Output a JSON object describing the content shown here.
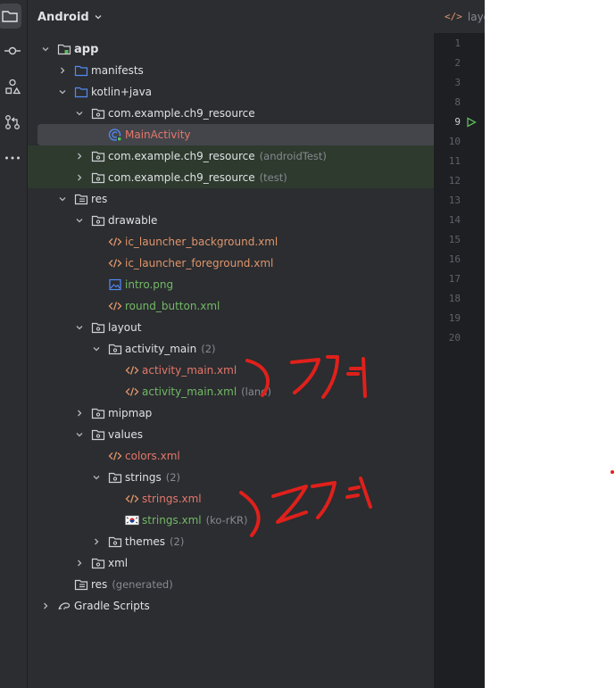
{
  "panel": {
    "view_name": "Android"
  },
  "tree": [
    {
      "label": "app",
      "type": "module",
      "level": 0,
      "expanded": true
    },
    {
      "label": "manifests",
      "type": "folder",
      "level": 1,
      "expanded": false
    },
    {
      "label": "kotlin+java",
      "type": "folder",
      "level": 1,
      "expanded": true
    },
    {
      "label": "com.example.ch9_resource",
      "type": "package",
      "level": 2,
      "expanded": true
    },
    {
      "label": "MainActivity",
      "type": "class",
      "level": 3,
      "color": "red",
      "selected": true
    },
    {
      "label": "com.example.ch9_resource",
      "type": "package",
      "level": 2,
      "expanded": false,
      "hint": "(androidTest)",
      "test": true
    },
    {
      "label": "com.example.ch9_resource",
      "type": "package",
      "level": 2,
      "expanded": false,
      "hint": "(test)",
      "test": true
    },
    {
      "label": "res",
      "type": "resfolder",
      "level": 1,
      "expanded": true
    },
    {
      "label": "drawable",
      "type": "package",
      "level": 2,
      "expanded": true
    },
    {
      "label": "ic_launcher_background.xml",
      "type": "xml",
      "level": 3,
      "color": "orange"
    },
    {
      "label": "ic_launcher_foreground.xml",
      "type": "xml",
      "level": 3,
      "color": "orange"
    },
    {
      "label": "intro.png",
      "type": "image",
      "level": 3,
      "color": "green"
    },
    {
      "label": "round_button.xml",
      "type": "xml",
      "level": 3,
      "color": "green"
    },
    {
      "label": "layout",
      "type": "package",
      "level": 2,
      "expanded": true
    },
    {
      "label": "activity_main",
      "type": "package",
      "level": 3,
      "expanded": true,
      "hint": "(2)"
    },
    {
      "label": "activity_main.xml",
      "type": "xml",
      "level": 4,
      "color": "red"
    },
    {
      "label": "activity_main.xml",
      "type": "xml",
      "level": 4,
      "color": "green",
      "hint": "(land)"
    },
    {
      "label": "mipmap",
      "type": "package",
      "level": 2,
      "expanded": false
    },
    {
      "label": "values",
      "type": "package",
      "level": 2,
      "expanded": true
    },
    {
      "label": "colors.xml",
      "type": "xml",
      "level": 3,
      "color": "red"
    },
    {
      "label": "strings",
      "type": "package",
      "level": 3,
      "expanded": true,
      "hint": "(2)"
    },
    {
      "label": "strings.xml",
      "type": "xml",
      "level": 4,
      "color": "red"
    },
    {
      "label": "strings.xml",
      "type": "flag",
      "level": 4,
      "color": "green",
      "hint": "(ko-rKR)"
    },
    {
      "label": "themes",
      "type": "package",
      "level": 3,
      "expanded": false,
      "hint": "(2)"
    },
    {
      "label": "xml",
      "type": "package",
      "level": 2,
      "expanded": false
    },
    {
      "label": "res",
      "type": "resfolder",
      "level": 1,
      "hint": "(generated)"
    },
    {
      "label": "Gradle Scripts",
      "type": "gradle",
      "level": 0,
      "expanded": false
    }
  ],
  "editor": {
    "tab_label": "layo",
    "line_numbers": [
      "1",
      "2",
      "3",
      "8",
      "9",
      "10",
      "11",
      "12",
      "13",
      "14",
      "15",
      "16",
      "17",
      "18",
      "19",
      "20"
    ],
    "current_line": "9"
  },
  "annotations": {
    "note_1": "2개",
    "note_2": "2개"
  },
  "colors": {
    "selected_row": "#43454a",
    "test_row": "#2e3a2e",
    "annotation": "#e0201b"
  }
}
